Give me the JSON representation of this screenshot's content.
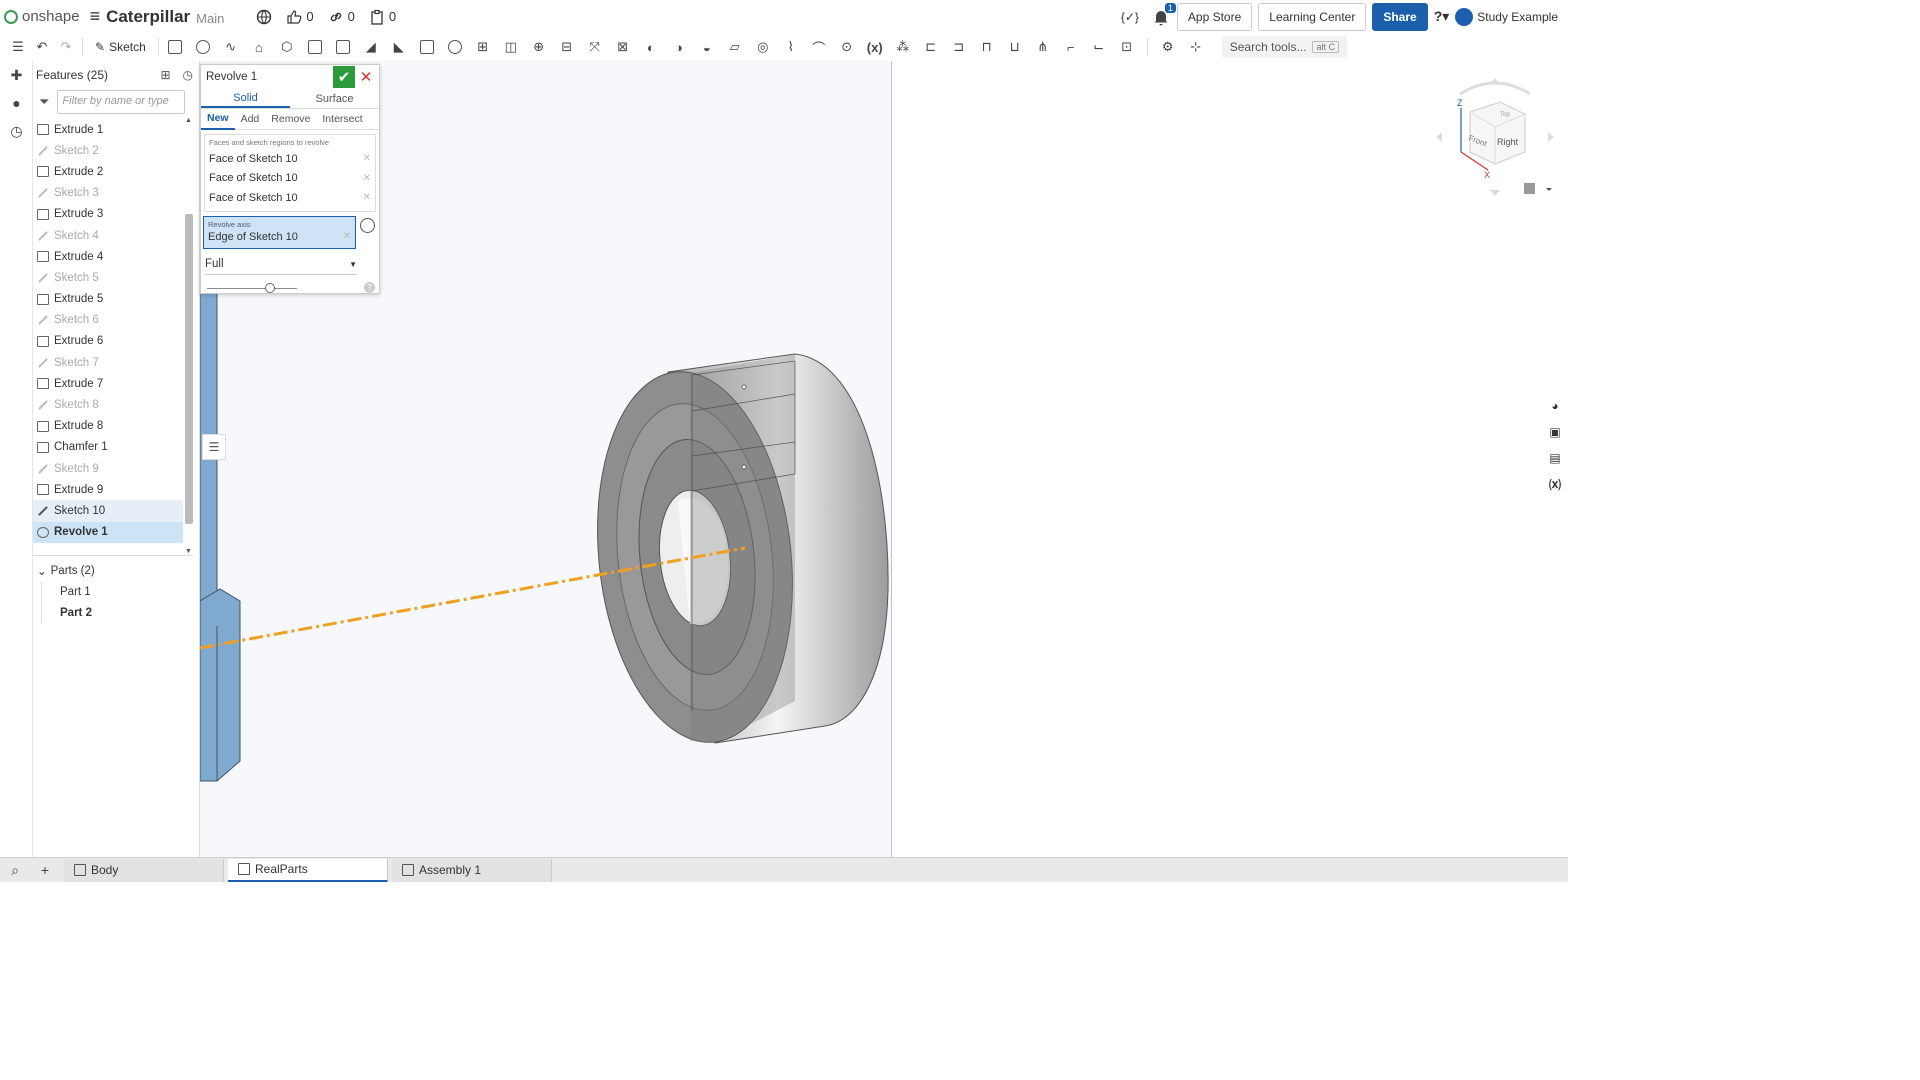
{
  "topbar": {
    "logo_text": "onshape",
    "doc_title": "Caterpillar",
    "branch": "Main",
    "likes": "0",
    "links": "0",
    "copies": "0",
    "notifications": "1",
    "app_store": "App Store",
    "learning_center": "Learning Center",
    "share": "Share",
    "user": "Study Example",
    "variables_icon": "{✓}"
  },
  "toolbar": {
    "sketch_label": "Sketch",
    "search_label": "Search tools...",
    "search_kbd": "alt C"
  },
  "features": {
    "header": "Features (25)",
    "filter_placeholder": "Filter by name or type",
    "items": [
      {
        "label": "Extrude 1",
        "type": "extrude"
      },
      {
        "label": "Sketch 2",
        "type": "sketch"
      },
      {
        "label": "Extrude 2",
        "type": "extrude"
      },
      {
        "label": "Sketch 3",
        "type": "sketch"
      },
      {
        "label": "Extrude 3",
        "type": "extrude"
      },
      {
        "label": "Sketch 4",
        "type": "sketch"
      },
      {
        "label": "Extrude 4",
        "type": "extrude"
      },
      {
        "label": "Sketch 5",
        "type": "sketch"
      },
      {
        "label": "Extrude 5",
        "type": "extrude"
      },
      {
        "label": "Sketch 6",
        "type": "sketch"
      },
      {
        "label": "Extrude 6",
        "type": "extrude"
      },
      {
        "label": "Sketch 7",
        "type": "sketch"
      },
      {
        "label": "Extrude 7",
        "type": "extrude"
      },
      {
        "label": "Sketch 8",
        "type": "sketch"
      },
      {
        "label": "Extrude 8",
        "type": "extrude"
      },
      {
        "label": "Chamfer 1",
        "type": "chamfer"
      },
      {
        "label": "Sketch 9",
        "type": "sketch"
      },
      {
        "label": "Extrude 9",
        "type": "extrude"
      },
      {
        "label": "Sketch 10",
        "type": "sketch-selected"
      },
      {
        "label": "Revolve 1",
        "type": "revolve-active"
      }
    ],
    "parts_header": "Parts (2)",
    "parts": [
      "Part 1",
      "Part 2"
    ]
  },
  "revolve_dialog": {
    "title": "Revolve 1",
    "tabs": [
      "Solid",
      "Surface"
    ],
    "ops": [
      "New",
      "Add",
      "Remove",
      "Intersect"
    ],
    "faces_label": "Faces and sketch regions to revolve",
    "faces": [
      "Face of Sketch 10",
      "Face of Sketch 10",
      "Face of Sketch 10"
    ],
    "axis_label": "Revolve axis",
    "axis_value": "Edge of Sketch 10",
    "type_value": "Full"
  },
  "viewcube": {
    "axis_z": "Z",
    "axis_x": "X",
    "face_front": "Front",
    "face_right": "Right",
    "face_top": "Top"
  },
  "bottom_tabs": [
    "Body",
    "RealParts",
    "Assembly 1"
  ],
  "colors": {
    "accent": "#1b5fad",
    "ok": "#2a9a3a",
    "axis_line": "#f0a020",
    "part_blue": "#7fa9cf"
  }
}
